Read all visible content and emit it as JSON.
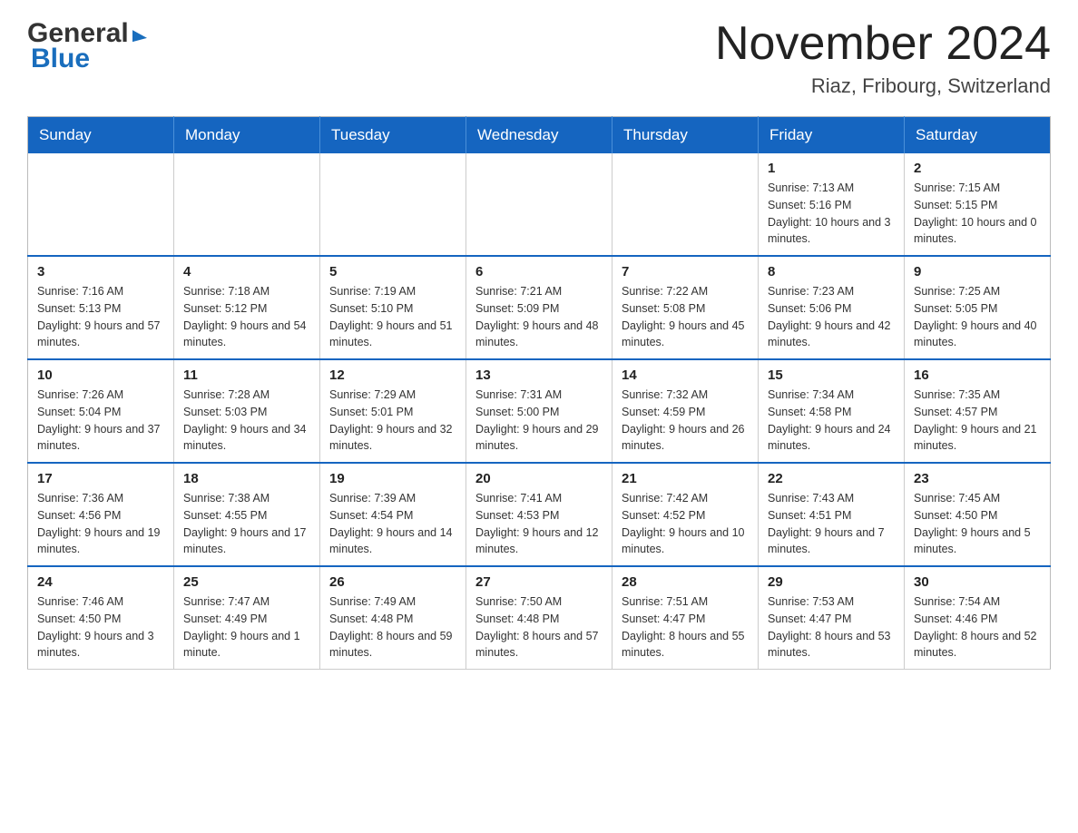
{
  "header": {
    "logo_general": "General",
    "logo_blue": "Blue",
    "month_title": "November 2024",
    "location": "Riaz, Fribourg, Switzerland"
  },
  "weekdays": [
    "Sunday",
    "Monday",
    "Tuesday",
    "Wednesday",
    "Thursday",
    "Friday",
    "Saturday"
  ],
  "weeks": [
    [
      {
        "day": "",
        "info": ""
      },
      {
        "day": "",
        "info": ""
      },
      {
        "day": "",
        "info": ""
      },
      {
        "day": "",
        "info": ""
      },
      {
        "day": "",
        "info": ""
      },
      {
        "day": "1",
        "info": "Sunrise: 7:13 AM\nSunset: 5:16 PM\nDaylight: 10 hours and 3 minutes."
      },
      {
        "day": "2",
        "info": "Sunrise: 7:15 AM\nSunset: 5:15 PM\nDaylight: 10 hours and 0 minutes."
      }
    ],
    [
      {
        "day": "3",
        "info": "Sunrise: 7:16 AM\nSunset: 5:13 PM\nDaylight: 9 hours and 57 minutes."
      },
      {
        "day": "4",
        "info": "Sunrise: 7:18 AM\nSunset: 5:12 PM\nDaylight: 9 hours and 54 minutes."
      },
      {
        "day": "5",
        "info": "Sunrise: 7:19 AM\nSunset: 5:10 PM\nDaylight: 9 hours and 51 minutes."
      },
      {
        "day": "6",
        "info": "Sunrise: 7:21 AM\nSunset: 5:09 PM\nDaylight: 9 hours and 48 minutes."
      },
      {
        "day": "7",
        "info": "Sunrise: 7:22 AM\nSunset: 5:08 PM\nDaylight: 9 hours and 45 minutes."
      },
      {
        "day": "8",
        "info": "Sunrise: 7:23 AM\nSunset: 5:06 PM\nDaylight: 9 hours and 42 minutes."
      },
      {
        "day": "9",
        "info": "Sunrise: 7:25 AM\nSunset: 5:05 PM\nDaylight: 9 hours and 40 minutes."
      }
    ],
    [
      {
        "day": "10",
        "info": "Sunrise: 7:26 AM\nSunset: 5:04 PM\nDaylight: 9 hours and 37 minutes."
      },
      {
        "day": "11",
        "info": "Sunrise: 7:28 AM\nSunset: 5:03 PM\nDaylight: 9 hours and 34 minutes."
      },
      {
        "day": "12",
        "info": "Sunrise: 7:29 AM\nSunset: 5:01 PM\nDaylight: 9 hours and 32 minutes."
      },
      {
        "day": "13",
        "info": "Sunrise: 7:31 AM\nSunset: 5:00 PM\nDaylight: 9 hours and 29 minutes."
      },
      {
        "day": "14",
        "info": "Sunrise: 7:32 AM\nSunset: 4:59 PM\nDaylight: 9 hours and 26 minutes."
      },
      {
        "day": "15",
        "info": "Sunrise: 7:34 AM\nSunset: 4:58 PM\nDaylight: 9 hours and 24 minutes."
      },
      {
        "day": "16",
        "info": "Sunrise: 7:35 AM\nSunset: 4:57 PM\nDaylight: 9 hours and 21 minutes."
      }
    ],
    [
      {
        "day": "17",
        "info": "Sunrise: 7:36 AM\nSunset: 4:56 PM\nDaylight: 9 hours and 19 minutes."
      },
      {
        "day": "18",
        "info": "Sunrise: 7:38 AM\nSunset: 4:55 PM\nDaylight: 9 hours and 17 minutes."
      },
      {
        "day": "19",
        "info": "Sunrise: 7:39 AM\nSunset: 4:54 PM\nDaylight: 9 hours and 14 minutes."
      },
      {
        "day": "20",
        "info": "Sunrise: 7:41 AM\nSunset: 4:53 PM\nDaylight: 9 hours and 12 minutes."
      },
      {
        "day": "21",
        "info": "Sunrise: 7:42 AM\nSunset: 4:52 PM\nDaylight: 9 hours and 10 minutes."
      },
      {
        "day": "22",
        "info": "Sunrise: 7:43 AM\nSunset: 4:51 PM\nDaylight: 9 hours and 7 minutes."
      },
      {
        "day": "23",
        "info": "Sunrise: 7:45 AM\nSunset: 4:50 PM\nDaylight: 9 hours and 5 minutes."
      }
    ],
    [
      {
        "day": "24",
        "info": "Sunrise: 7:46 AM\nSunset: 4:50 PM\nDaylight: 9 hours and 3 minutes."
      },
      {
        "day": "25",
        "info": "Sunrise: 7:47 AM\nSunset: 4:49 PM\nDaylight: 9 hours and 1 minute."
      },
      {
        "day": "26",
        "info": "Sunrise: 7:49 AM\nSunset: 4:48 PM\nDaylight: 8 hours and 59 minutes."
      },
      {
        "day": "27",
        "info": "Sunrise: 7:50 AM\nSunset: 4:48 PM\nDaylight: 8 hours and 57 minutes."
      },
      {
        "day": "28",
        "info": "Sunrise: 7:51 AM\nSunset: 4:47 PM\nDaylight: 8 hours and 55 minutes."
      },
      {
        "day": "29",
        "info": "Sunrise: 7:53 AM\nSunset: 4:47 PM\nDaylight: 8 hours and 53 minutes."
      },
      {
        "day": "30",
        "info": "Sunrise: 7:54 AM\nSunset: 4:46 PM\nDaylight: 8 hours and 52 minutes."
      }
    ]
  ]
}
